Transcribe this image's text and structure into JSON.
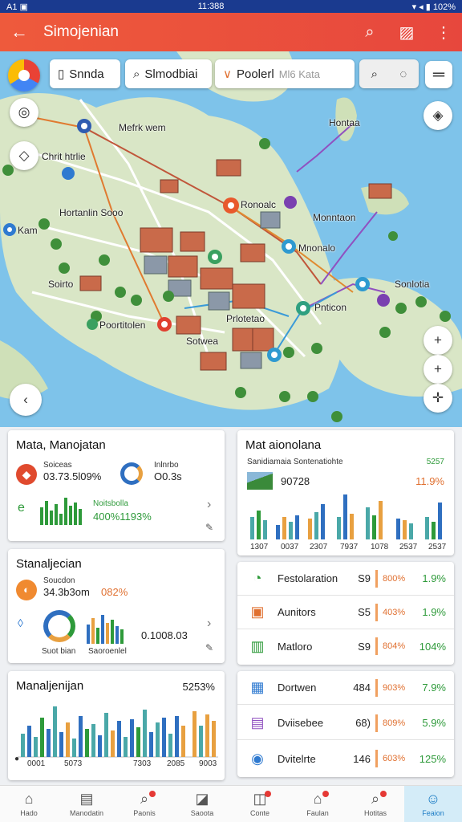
{
  "status": {
    "left": "A1 ▣",
    "time": "11:388",
    "right": "▾ ◂ ▮ 102%"
  },
  "appbar": {
    "title": "Simojenian"
  },
  "map": {
    "search1": "Snnda",
    "search2": "Slmodbiai",
    "search3": "Poolerl",
    "search3_placeholder": "Ml6 Kata",
    "labels": [
      "Mefrk wem",
      "Chrit htrlie",
      "Hortanlin Sooo",
      "Kam",
      "Ronoalc",
      "Hontaa",
      "Monntaon",
      "Mnonalo",
      "Sonlotia",
      "Soirto",
      "Poortitolen",
      "Sotwea",
      "Prlotetao",
      "Pnticon"
    ]
  },
  "card1": {
    "title": "Mata, Manojatan",
    "stat1_label": "Soiceas",
    "stat1_value": "03.73.5l09%",
    "stat2_label": "Inlnrbo",
    "stat2_value": "O0.3s",
    "spark_label": "Noitsbolla",
    "spark_value": "400%1193%"
  },
  "card2": {
    "title": "Stanaljecian",
    "stat_label": "Soucdon",
    "stat_value": "34.3b3om",
    "stat_value2": "082%",
    "legend1": "Suot bian",
    "legend2": "Saoroenlel",
    "value": "0.1008.03"
  },
  "card3": {
    "title": "Manaljenijan",
    "value": "5253%",
    "ticks": [
      "0001",
      "5073",
      "7303",
      "2085",
      "9003"
    ]
  },
  "card4": {
    "title": "Mat aionolana",
    "subtitle": "Sanidiamaia Sontenatiohte",
    "subtitle_value": "5257",
    "mini_value": "90728",
    "mini_pct": "11.9%",
    "ticks": [
      "1307",
      "0037",
      "2307",
      "7937",
      "1078",
      "2537",
      "2537"
    ]
  },
  "table1": [
    {
      "icon": "◔",
      "label": "Festolaration",
      "num": "S9",
      "pct": "800%",
      "growth": "1.9%"
    },
    {
      "icon": "▣",
      "label": "Aunitors",
      "num": "S5",
      "pct": "403%",
      "growth": "1.9%"
    },
    {
      "icon": "▥",
      "label": "Matloro",
      "num": "S9",
      "pct": "804%",
      "growth": "104%"
    }
  ],
  "table2": [
    {
      "icon": "▦",
      "label": "Dortwen",
      "num": "484",
      "pct": "903%",
      "growth": "7.9%"
    },
    {
      "icon": "▤",
      "label": "Dviisebee",
      "num": "68)",
      "pct": "809%",
      "growth": "5.9%"
    },
    {
      "icon": "◉",
      "label": "Dvitelrte",
      "num": "146",
      "pct": "603%",
      "growth": "125%"
    }
  ],
  "nav": [
    {
      "icon": "⌂",
      "label": "Hado",
      "badge": false
    },
    {
      "icon": "▤",
      "label": "Manodatin",
      "badge": false
    },
    {
      "icon": "⌕",
      "label": "Paonis",
      "badge": true
    },
    {
      "icon": "◪",
      "label": "Saoota",
      "badge": false
    },
    {
      "icon": "◫",
      "label": "Conte",
      "badge": true
    },
    {
      "icon": "⌂",
      "label": "Faulan",
      "badge": true
    },
    {
      "icon": "⌕",
      "label": "Hotitas",
      "badge": true
    },
    {
      "icon": "☺",
      "label": "Feaion",
      "badge": false
    }
  ],
  "colors": {
    "appbar": "#e94e3c",
    "water": "#7ec3ea",
    "land": "#d9e6c6",
    "accent_green": "#2e9a3a",
    "accent_orange": "#e07030"
  }
}
